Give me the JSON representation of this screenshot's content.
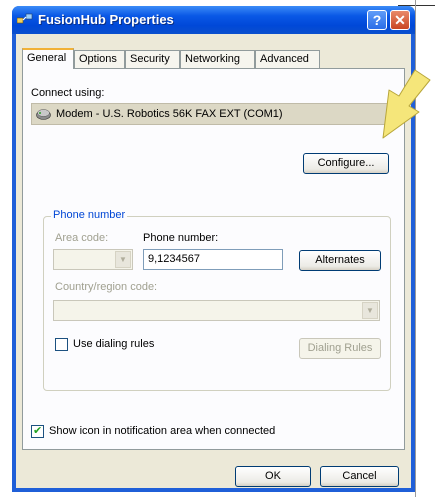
{
  "window": {
    "title": "FusionHub Properties",
    "help_label": "?",
    "close_label": "✕"
  },
  "tabs": [
    {
      "label": "General",
      "active": true
    },
    {
      "label": "Options"
    },
    {
      "label": "Security"
    },
    {
      "label": "Networking"
    },
    {
      "label": "Advanced"
    }
  ],
  "general": {
    "connect_using_label": "Connect using:",
    "device": "Modem - U.S. Robotics 56K FAX EXT (COM1)",
    "configure_label": "Configure...",
    "phone_group_title": "Phone number",
    "area_code_label": "Area code:",
    "phone_number_label": "Phone number:",
    "phone_number_value": "9,1234567",
    "alternates_label": "Alternates",
    "country_label": "Country/region code:",
    "use_dialing_rules_label": "Use dialing rules",
    "use_dialing_rules_checked": false,
    "dialing_rules_label": "Dialing Rules",
    "show_icon_label": "Show icon in notification area when connected",
    "show_icon_checked": true
  },
  "footer": {
    "ok_label": "OK",
    "cancel_label": "Cancel"
  },
  "icons": {
    "title": "network-connection-icon",
    "modem": "modem-icon",
    "annotation": "yellow-arrow-pointer-icon"
  },
  "colors": {
    "titlebar": "#0a58e6",
    "group_title": "#0046d5",
    "annotation_arrow": "#f5e67a"
  }
}
